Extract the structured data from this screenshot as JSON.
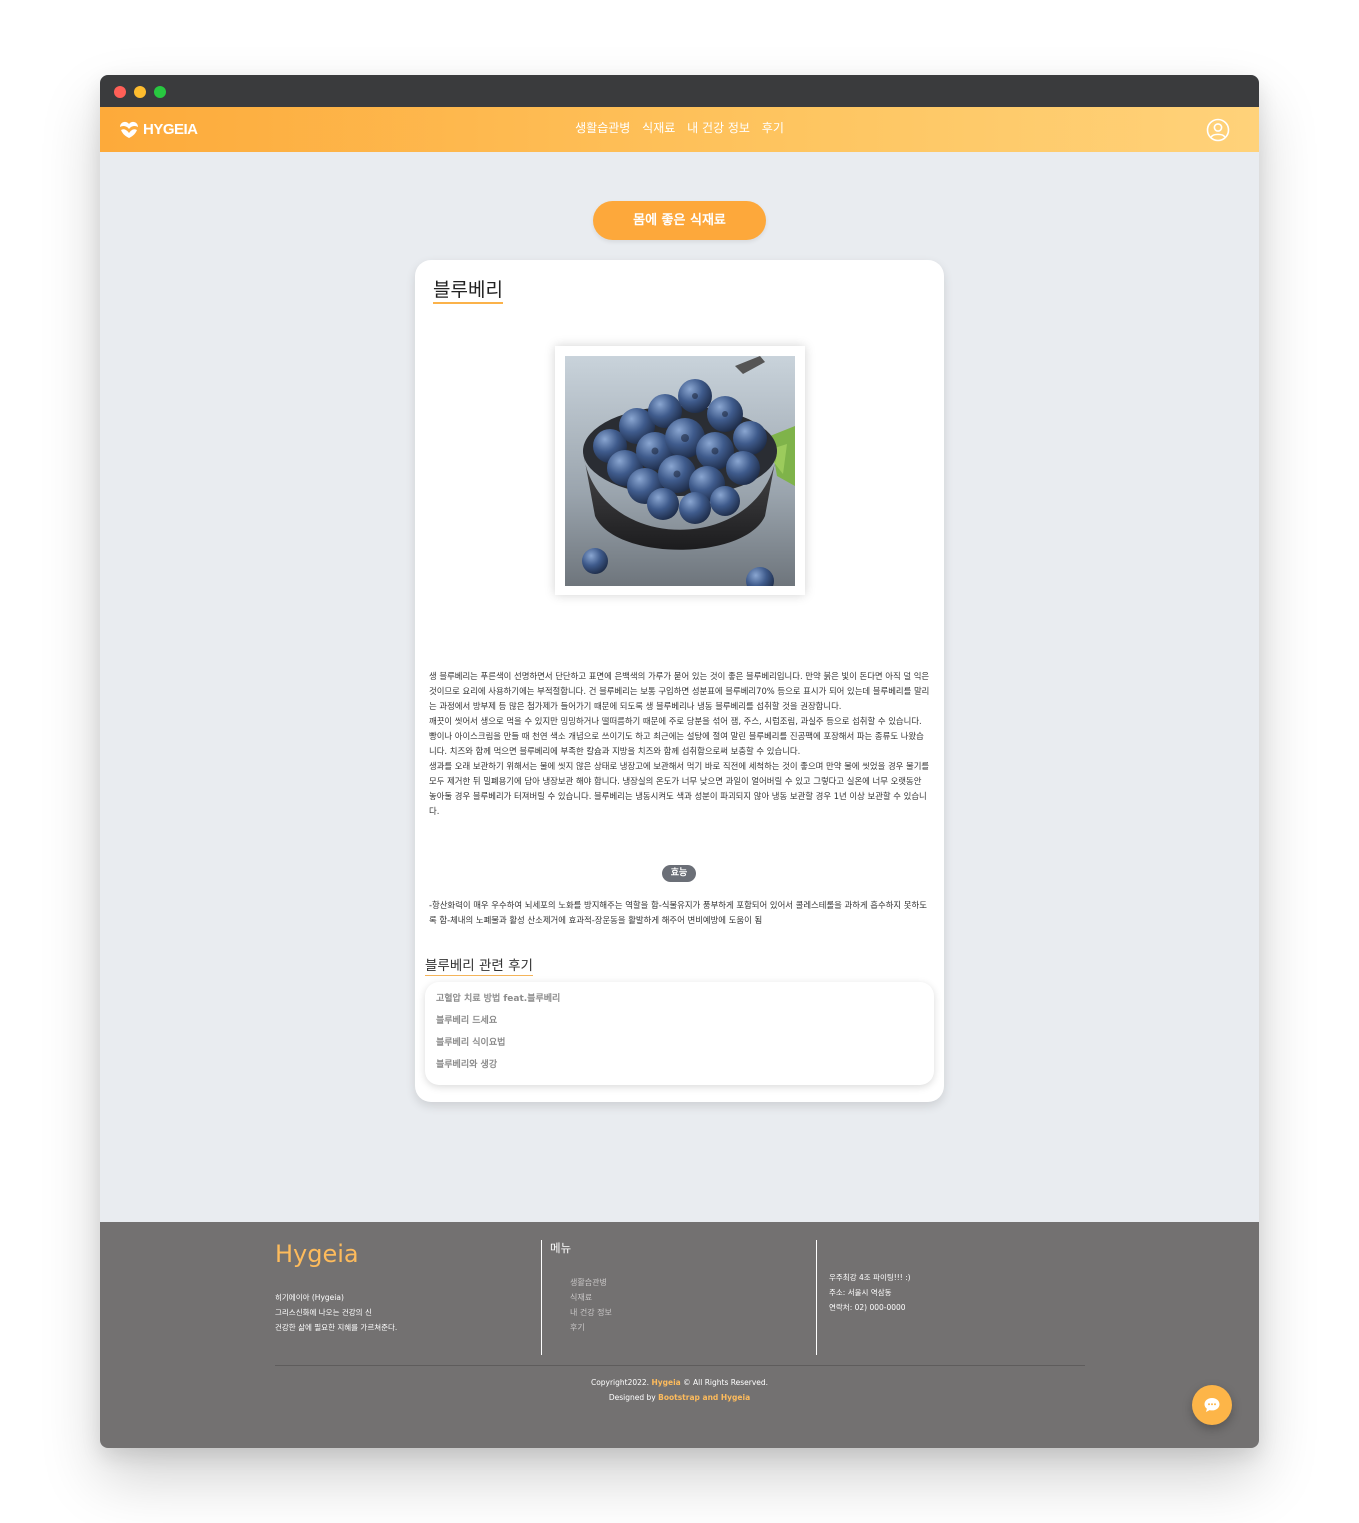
{
  "navbar": {
    "brand": "HYGEIA",
    "links": [
      "생활습관병",
      "식재료",
      "내 건강 정보",
      "후기"
    ]
  },
  "page": {
    "section_button": "몸에 좋은 식재료"
  },
  "food": {
    "title": "블루베리",
    "description": [
      "생 블루베리는 푸른색이 선명하면서 단단하고 표면에 은백색의 가루가 묻어 있는 것이 좋은 블루베리입니다. 만약 붉은 빛이 돈다면 아직 덜 익은 것이므로 요리에 사용하기에는 부적절합니다. 건 블루베리는 보통 구입하면 성분표에 블루베리70% 등으로 표시가 되어 있는데 블루베리를 말리는 과정에서 방부제 등 많은 첨가제가 들어가기 때문에 되도록 생 블루베리나 냉동 블루베리를 섭취할 것을 권장합니다.",
      "깨끗이 씻어서 생으로 먹을 수 있지만 밍밍하거나 떨떠름하기 때문에 주로 당분을 섞어 잼, 주스, 시럽조림, 과실주 등으로 섭취할 수 있습니다. 빵이나 아이스크림을 만들 때 천연 색소 개념으로 쓰이기도 하고 최근에는 설탕에 절여 말린 블루베리를 진공팩에 포장해서 파는 종류도 나왔습니다. 치즈와 함께 먹으면 블루베리에 부족한 칼슘과 지방을 치즈와 함께 섭취함으로써 보충할 수 있습니다.",
      "생과를 오래 보관하기 위해서는 물에 씻지 않은 상태로 냉장고에 보관해서 먹기 바로 직전에 세척하는 것이 좋으며 만약 물에 씻었을 경우 물기를 모두 제거한 뒤 밀폐용기에 담아 냉장보관 해야 합니다. 냉장실의 온도가 너무 낮으면 과일이 얼어버릴 수 있고 그렇다고 실온에 너무 오랫동안 놓아둘 경우 블루베리가 터져버릴 수 있습니다. 블루베리는 냉동시켜도 색과 성분이 파괴되지 않아 냉동 보관할 경우 1년 이상 보관할 수 있습니다."
    ],
    "effect_badge": "효능",
    "effect_text": "-항산화력이 매우 우수하여 뇌세포의 노화를 방지해주는 역할을 함-식물유지가 풍부하게 포함되어 있어서 콜레스테롤을 과하게 흡수하지 못하도록 함-체내의 노폐물과 활성 산소제거에 효과적-장운동을 활발하게 해주어 변비예방에 도움이 됨"
  },
  "reviews": {
    "title": "블루베리 관련 후기",
    "items": [
      "고혈압 치료 방법 feat.블루베리",
      "블루베리 드세요",
      "블루베리 식이요법",
      "블루베리와 생강"
    ]
  },
  "footer": {
    "brand": "Hygeia",
    "about": [
      "히기에이아 (Hygeia)",
      "그리스신화에 나오는 건강의 신",
      "건강한 삶에 필요한 지혜를 가르쳐준다."
    ],
    "menu_title": "메뉴",
    "menu": [
      "생활습관병",
      "식재료",
      "내 건강 정보",
      "후기"
    ],
    "contact": [
      "우주최강 4조 파이팅!!! :)",
      "주소: 서울시 역삼동",
      "연락처: 02) 000-0000"
    ],
    "copyright_prefix": "Copyright2022.",
    "copyright_brand": "Hygeia",
    "copyright_suffix": "© All Rights Reserved.",
    "designed_prefix": "Designed by",
    "designed_by": "Bootstrap and Hygeia"
  },
  "colors": {
    "accent": "#fda83b",
    "footer_bg": "#737171",
    "page_bg": "#e9ecf0"
  },
  "icons": [
    "logo-leaf-icon",
    "user-circle-icon",
    "chat-bubble-icon"
  ]
}
